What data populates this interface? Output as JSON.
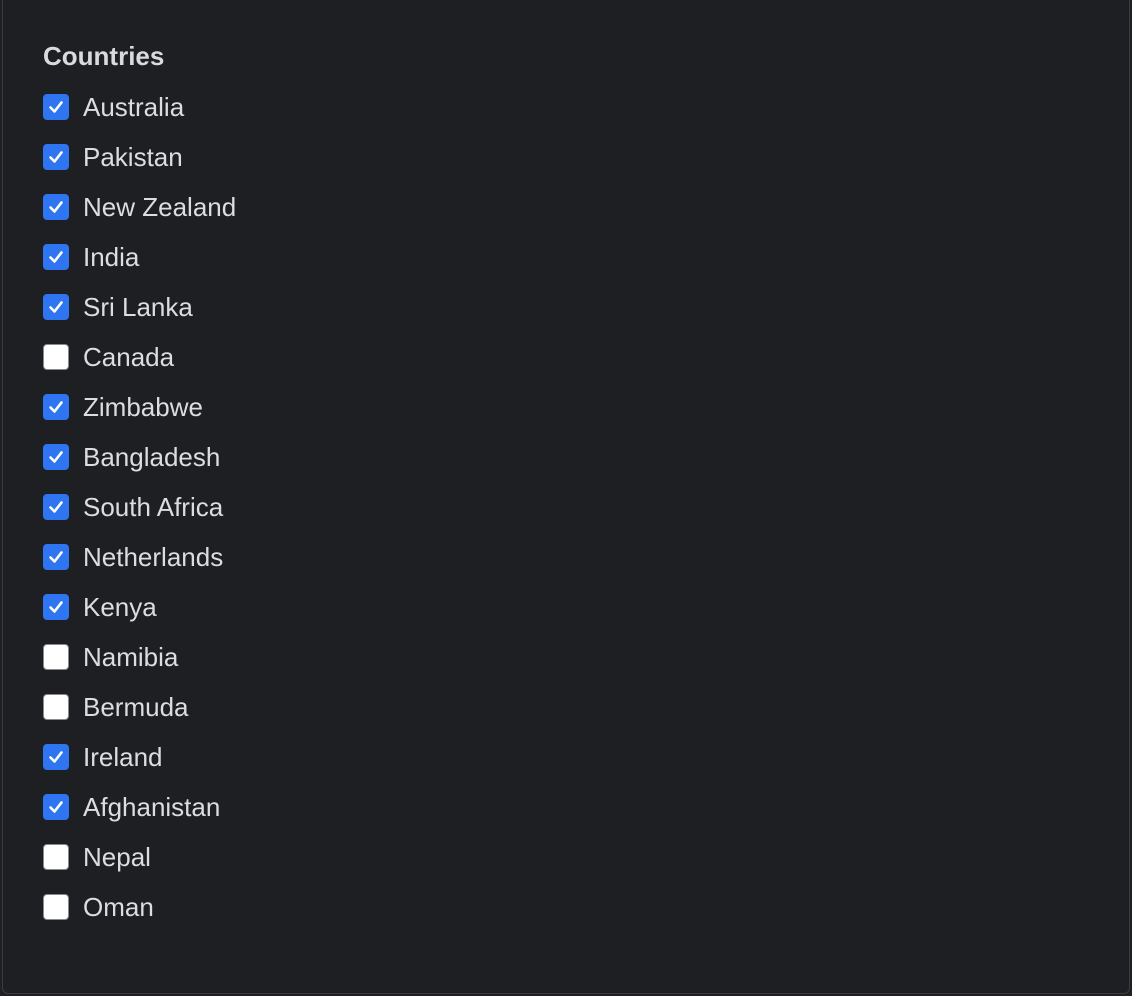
{
  "filter": {
    "title": "Countries",
    "colors": {
      "checked": "#2f74f1",
      "unchecked": "#ffffff",
      "text": "#dcdde0",
      "background": "#1e1f22"
    },
    "options": [
      {
        "label": "Australia",
        "checked": true
      },
      {
        "label": "Pakistan",
        "checked": true
      },
      {
        "label": "New Zealand",
        "checked": true
      },
      {
        "label": "India",
        "checked": true
      },
      {
        "label": "Sri Lanka",
        "checked": true
      },
      {
        "label": "Canada",
        "checked": false
      },
      {
        "label": "Zimbabwe",
        "checked": true
      },
      {
        "label": "Bangladesh",
        "checked": true
      },
      {
        "label": "South Africa",
        "checked": true
      },
      {
        "label": "Netherlands",
        "checked": true
      },
      {
        "label": "Kenya",
        "checked": true
      },
      {
        "label": "Namibia",
        "checked": false
      },
      {
        "label": "Bermuda",
        "checked": false
      },
      {
        "label": "Ireland",
        "checked": true
      },
      {
        "label": "Afghanistan",
        "checked": true
      },
      {
        "label": "Nepal",
        "checked": false
      },
      {
        "label": "Oman",
        "checked": false
      }
    ]
  }
}
